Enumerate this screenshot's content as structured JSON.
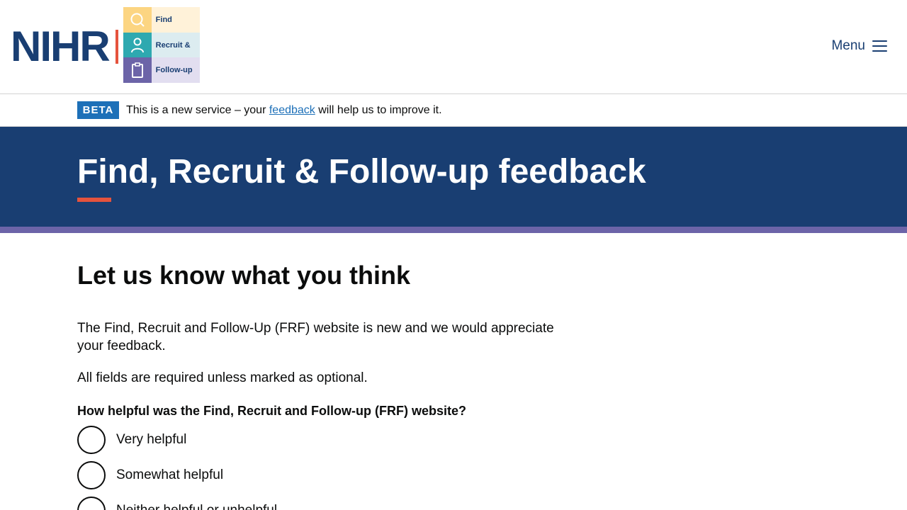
{
  "header": {
    "logo_text": "NIHR",
    "tiles": [
      {
        "label": "Find",
        "icon": "search-icon"
      },
      {
        "label": "Recruit &",
        "icon": "person-icon"
      },
      {
        "label": "Follow-up",
        "icon": "clipboard-icon"
      }
    ],
    "menu_label": "Menu",
    "menu_icon": "hamburger-icon"
  },
  "beta": {
    "tag": "BETA",
    "text_before": "This is a new service – your",
    "link": "feedback",
    "text_after": "will help us to improve it."
  },
  "hero": {
    "title": "Find, Recruit & Follow-up feedback"
  },
  "main": {
    "heading": "Let us know what you think",
    "intro": "The Find, Recruit and Follow-Up (FRF) website is new and we would appreciate your feedback.",
    "required_note": "All fields are required unless marked as optional.",
    "question": "How helpful was the Find, Recruit and Follow-up (FRF) website?",
    "options": [
      "Very helpful",
      "Somewhat helpful",
      "Neither helpful or unhelpful"
    ]
  },
  "colors": {
    "navy": "#193e72",
    "accent_red": "#e5533d",
    "purple": "#6c64a8",
    "link_blue": "#1d70b8"
  }
}
